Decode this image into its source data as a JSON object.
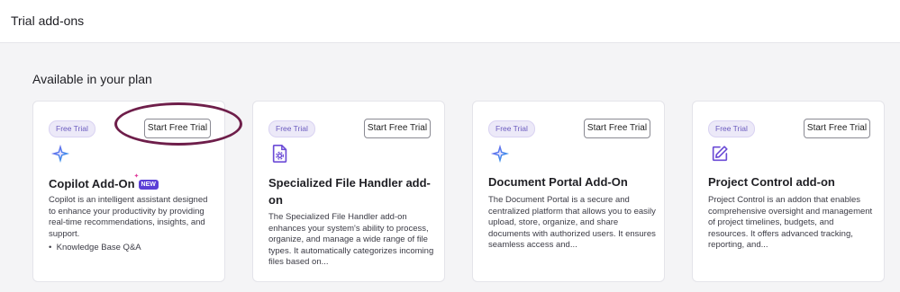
{
  "header": {
    "title": "Trial add-ons"
  },
  "section": {
    "title": "Available in your plan"
  },
  "cards": [
    {
      "badge": "Free Trial",
      "button": "Start Free Trial",
      "icon": "sparkle-star-icon",
      "title": "Copilot Add-On",
      "new_badge": "NEW",
      "description": "Copilot is an intelligent assistant designed to enhance your productivity by providing real-time recommendations, insights, and support.",
      "bullets": [
        "Knowledge Base Q&A"
      ]
    },
    {
      "badge": "Free Trial",
      "button": "Start Free Trial",
      "icon": "file-settings-icon",
      "title": "Specialized File Handler add-on",
      "description": "The Specialized File Handler add-on enhances your system's ability to process, organize, and manage a wide range of file types. It automatically categorizes incoming files based on..."
    },
    {
      "badge": "Free Trial",
      "button": "Start Free Trial",
      "icon": "sparkle-star-icon",
      "title": "Document Portal Add-On",
      "description": "The Document Portal is a secure and centralized platform that allows you to easily upload, store, organize, and share documents with authorized users. It ensures seamless access and..."
    },
    {
      "badge": "Free Trial",
      "button": "Start Free Trial",
      "icon": "edit-square-icon",
      "title": "Project Control add-on",
      "description": "Project Control is an addon that enables comprehensive oversight and management of project timelines, budgets, and resources. It offers advanced tracking, reporting, and..."
    }
  ],
  "colors": {
    "accent": "#6b5bbf",
    "highlight_ring": "#6e1e4a",
    "new_badge": "#5b3fd6"
  }
}
